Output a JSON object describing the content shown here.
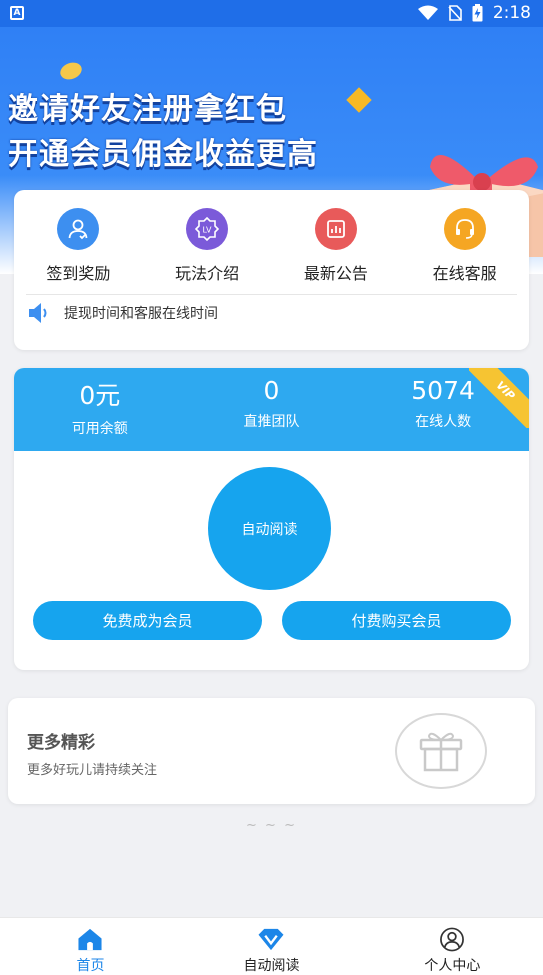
{
  "status_bar": {
    "time": "2:18",
    "app_badge": "A"
  },
  "banner": {
    "line1": "邀请好友注册拿红包",
    "line2": "开通会员佣金收益更高"
  },
  "menu": [
    {
      "label": "签到奖励",
      "icon": "user-checkin-icon",
      "color": "#3d8ff0"
    },
    {
      "label": "玩法介绍",
      "icon": "lv-badge-icon",
      "color": "#7b5ad9"
    },
    {
      "label": "最新公告",
      "icon": "announcement-icon",
      "color": "#e85a5a"
    },
    {
      "label": "在线客服",
      "icon": "headset-icon",
      "color": "#f5a623"
    }
  ],
  "notice": {
    "text": "提现时间和客服在线时间"
  },
  "stats": [
    {
      "value": "0元",
      "label": "可用余额"
    },
    {
      "value": "0",
      "label": "直推团队"
    },
    {
      "value": "5074",
      "label": "在线人数"
    }
  ],
  "vip_badge": "VIP",
  "auto_read_button": "自动阅读",
  "free_member_button": "免费成为会员",
  "paid_member_button": "付费购买会员",
  "more": {
    "title": "更多精彩",
    "subtitle": "更多好玩儿请持续关注"
  },
  "tilde": "~ ~ ~",
  "tabs": [
    {
      "label": "首页",
      "icon": "home-icon",
      "active": true
    },
    {
      "label": "自动阅读",
      "icon": "vip-diamond-icon",
      "active": false
    },
    {
      "label": "个人中心",
      "icon": "profile-icon",
      "active": false
    }
  ],
  "colors": {
    "primary": "#16a4ee",
    "stats_bg": "#2ea9f0",
    "status_bar": "#1f6ee8",
    "active_tab": "#1c86e8",
    "vip": "#f6c432"
  }
}
